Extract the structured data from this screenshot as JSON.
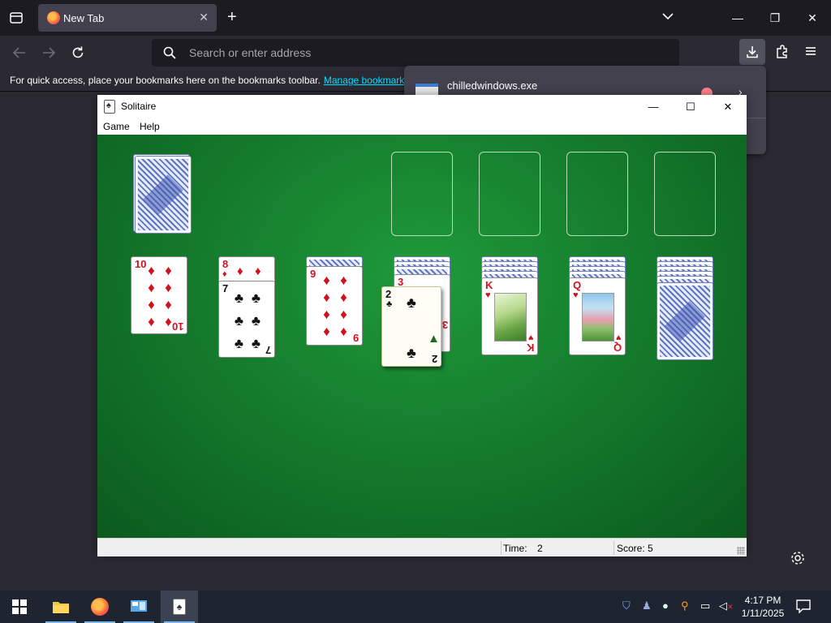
{
  "browser": {
    "tab_title": "New Tab",
    "search_placeholder": "Search or enter address",
    "bookmarks_text": "For quick access, place your bookmarks here on the bookmarks toolbar.",
    "bookmarks_link": "Manage bookmarks",
    "download_file": "chilledwindows.exe"
  },
  "solitaire": {
    "title": "Solitaire",
    "menu": {
      "game": "Game",
      "help": "Help"
    },
    "status": {
      "time_label": "Time:",
      "time_value": "2",
      "score_label": "Score: 5"
    },
    "tableau": [
      {
        "rank": "10",
        "suit": "♦",
        "color": "red"
      },
      {
        "rank": "8",
        "suit": "♦",
        "color": "red",
        "covered": true
      },
      {
        "rank": "7",
        "suit": "♣",
        "color": "black"
      },
      {
        "rank": "9",
        "suit": "♦",
        "color": "red"
      },
      {
        "rank": "3",
        "suit": "♦",
        "color": "red",
        "covered": true
      },
      {
        "rank": "K",
        "suit": "♥",
        "color": "red"
      },
      {
        "rank": "Q",
        "suit": "♥",
        "color": "red"
      }
    ],
    "dragging_card": {
      "rank": "2",
      "suit": "♣",
      "color": "black"
    }
  },
  "taskbar": {
    "time": "4:17 PM",
    "date": "1/11/2025"
  },
  "colors": {
    "felt": "#157d2d",
    "link": "#00ddff",
    "chrome_dark": "#1c1b22",
    "chrome": "#2b2a33"
  }
}
